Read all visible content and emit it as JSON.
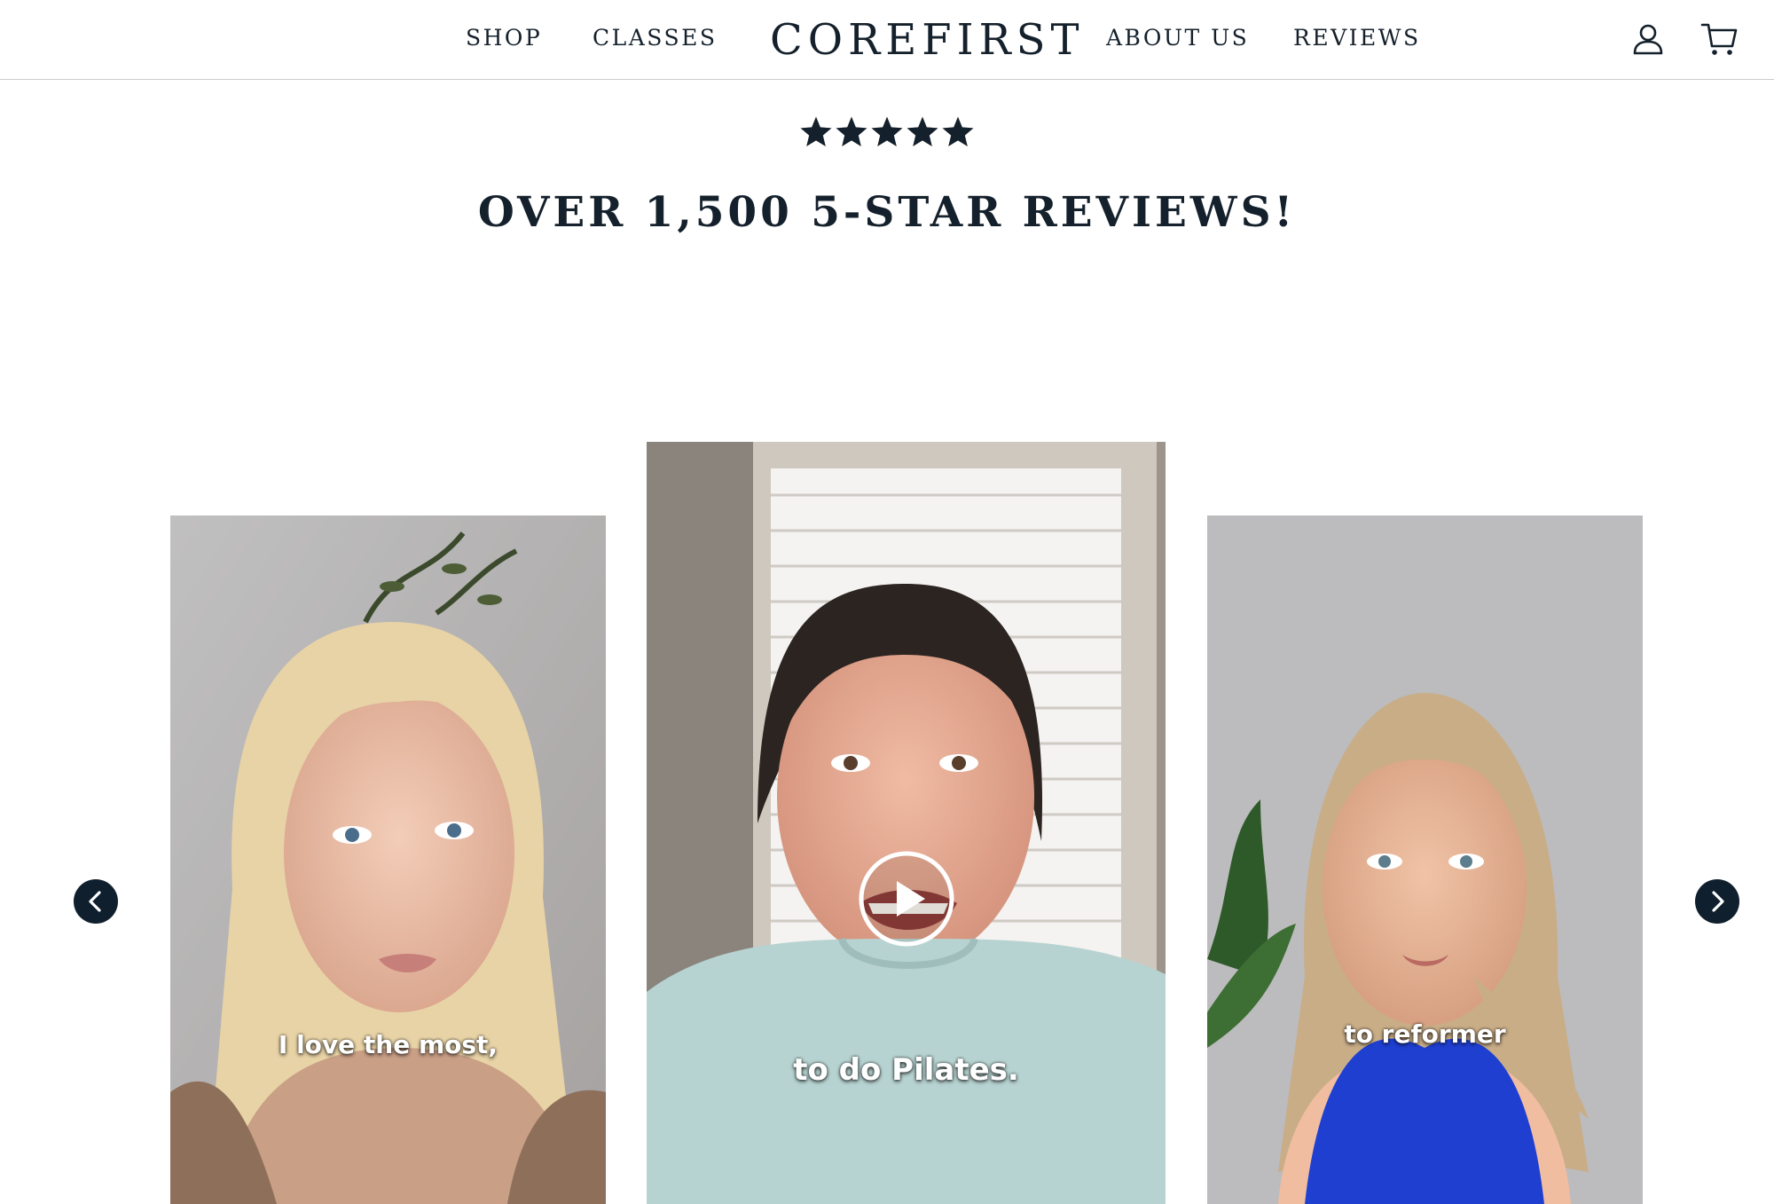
{
  "header": {
    "brand": "COREFIRST",
    "nav_left": [
      {
        "label": "SHOP"
      },
      {
        "label": "CLASSES"
      }
    ],
    "nav_right": [
      {
        "label": "ABOUT US"
      },
      {
        "label": "REVIEWS"
      }
    ],
    "icons": [
      "account-icon",
      "cart-icon"
    ]
  },
  "reviews": {
    "rating": 5,
    "rating_max": 5,
    "heading": "OVER 1,500 5-STAR REVIEWS!"
  },
  "carousel": {
    "cards": [
      {
        "caption": "I love the most,"
      },
      {
        "caption": "to do Pilates."
      },
      {
        "caption": "to reformer"
      }
    ],
    "prev_icon": "chevron-left-icon",
    "next_icon": "chevron-right-icon",
    "play_icon": "play-icon"
  },
  "colors": {
    "text": "#14202b",
    "arrow_bg": "#0f1f2e",
    "divider": "#c9cdd1"
  }
}
